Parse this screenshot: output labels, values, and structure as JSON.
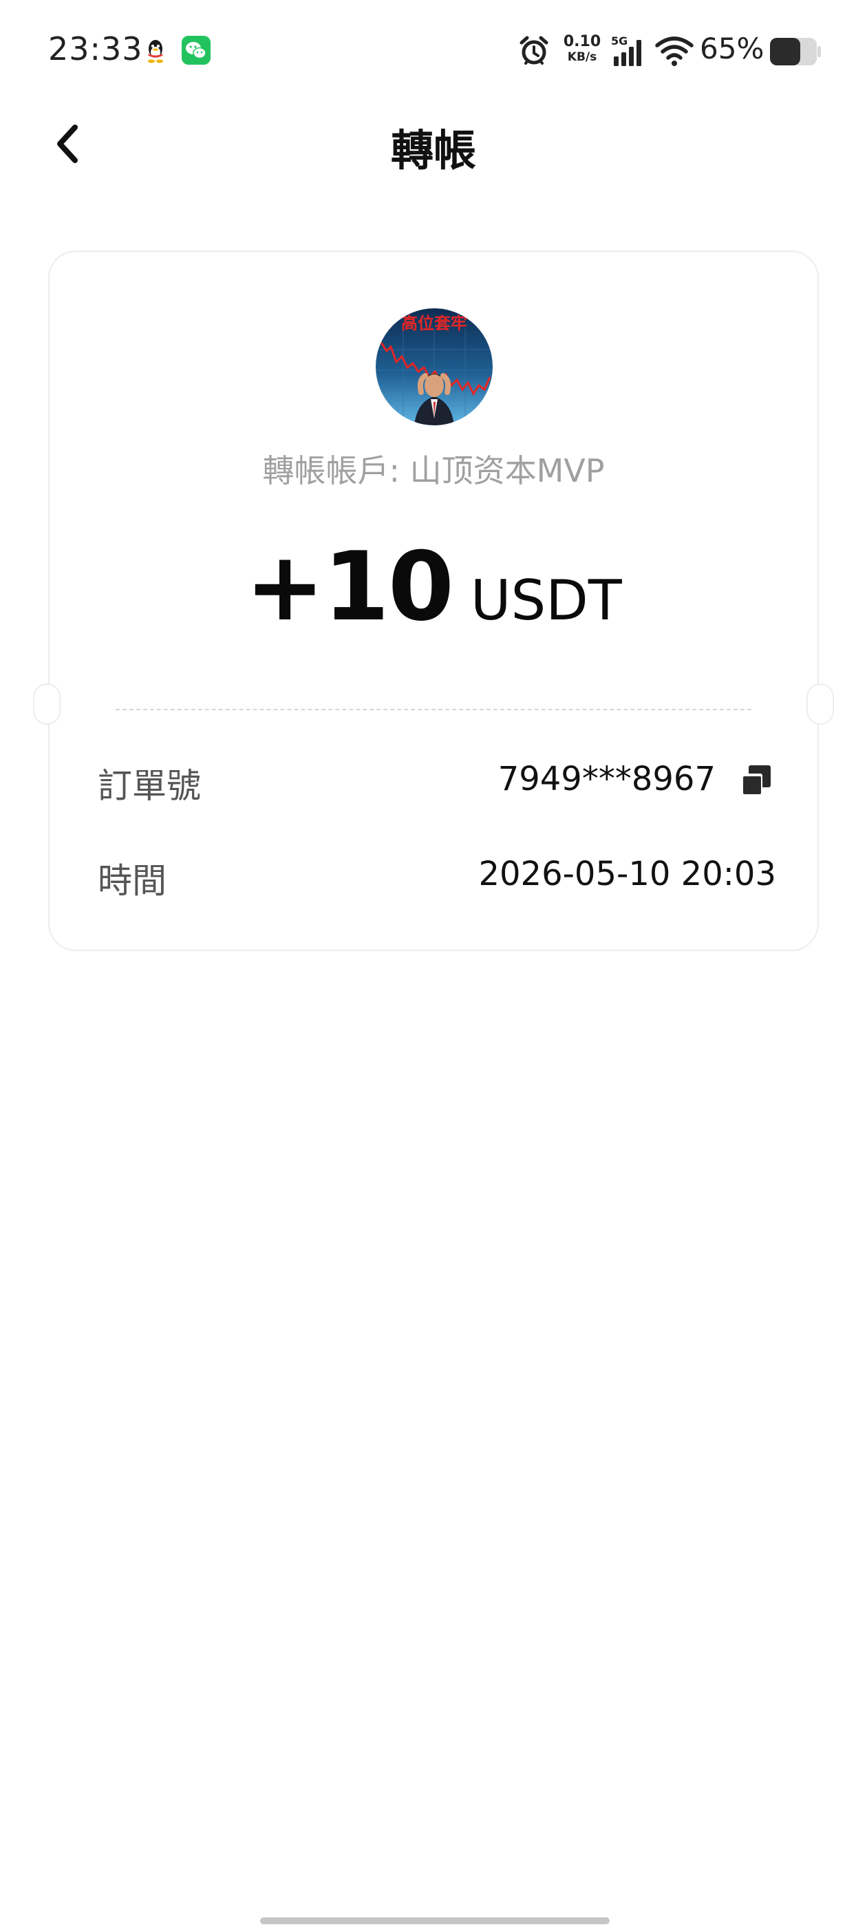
{
  "status_bar": {
    "time": "23:33",
    "network_speed_value": "0.10",
    "network_speed_unit": "KB/s",
    "network_type": "5G",
    "battery_percent": "65%",
    "battery_level": 0.65,
    "notification_icons": [
      "qq-icon",
      "wechat-icon"
    ],
    "system_icons": [
      "alarm-icon",
      "signal-icon",
      "wifi-icon",
      "battery-icon"
    ]
  },
  "header": {
    "title": "轉帳",
    "back_icon": "chevron-left-icon"
  },
  "transfer": {
    "avatar_text": "高位套牢",
    "account_label": "轉帳帳戶:",
    "account_name": "山顶资本MVP",
    "amount": "+10",
    "currency": "USDT"
  },
  "details": {
    "order_label": "訂單號",
    "order_value": "7949***8967",
    "copy_icon": "copy-icon",
    "time_label": "時間",
    "time_value": "2026-05-10 20:03"
  },
  "colors": {
    "background": "#ffffff",
    "text_primary": "#111111",
    "text_secondary": "#a0a0a0",
    "card_border": "#ededed",
    "wechat_green": "#22c35e"
  }
}
